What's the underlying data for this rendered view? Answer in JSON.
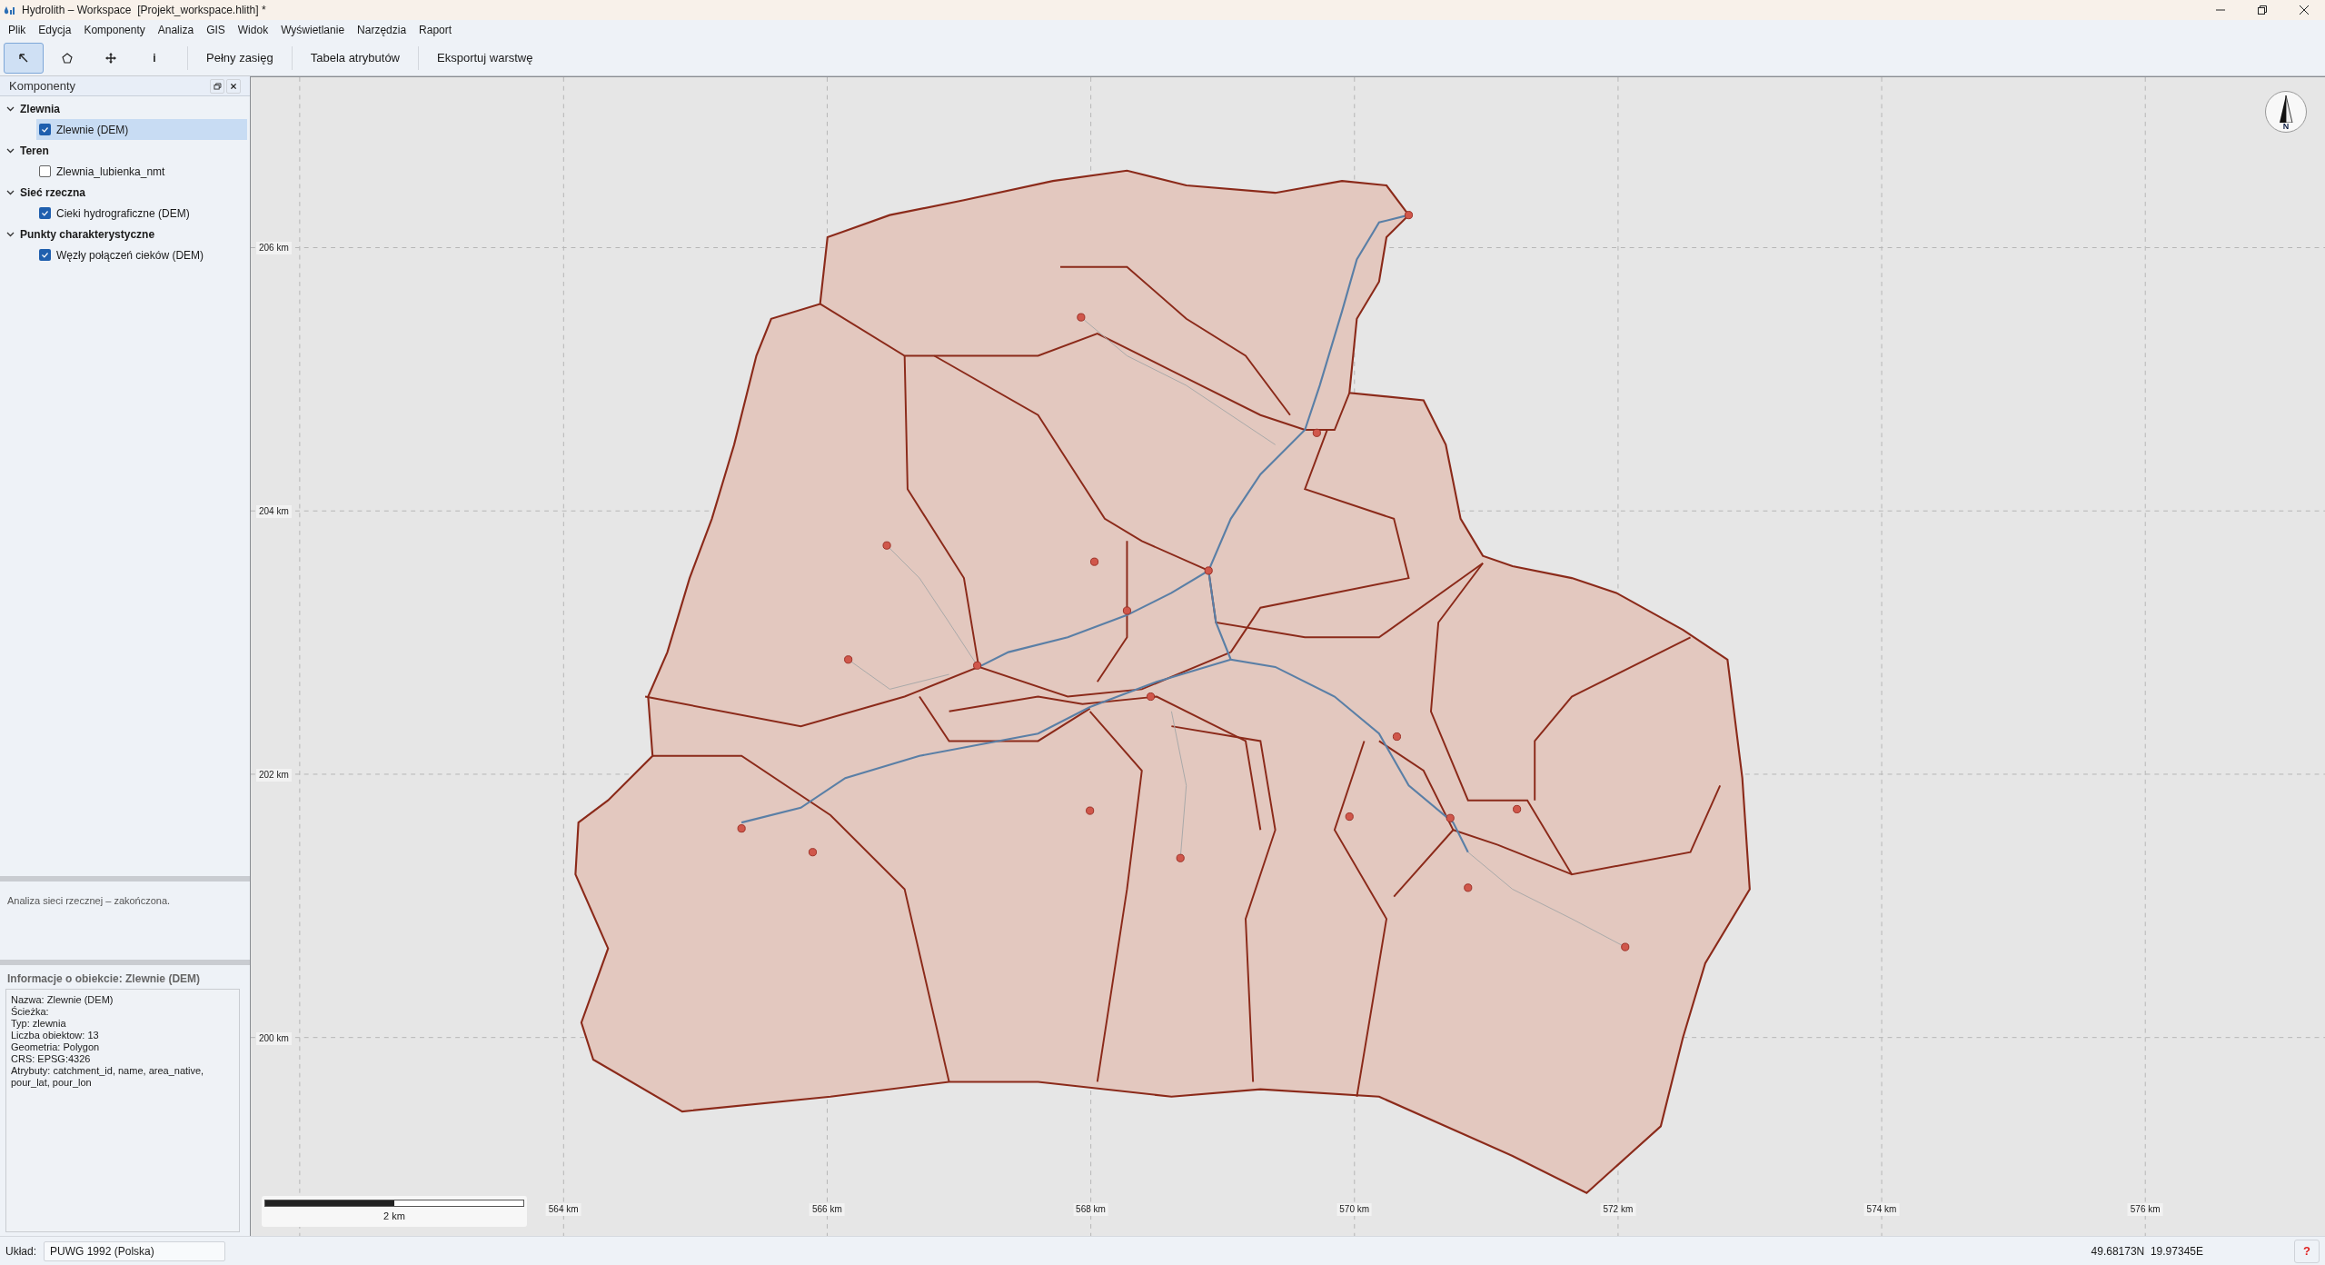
{
  "window": {
    "title": "Hydrolith – Workspace  [Projekt_workspace.hlith] *"
  },
  "menu": [
    "Plik",
    "Edycja",
    "Komponenty",
    "Analiza",
    "GIS",
    "Widok",
    "Wyświetlanie",
    "Narzędzia",
    "Raport"
  ],
  "toolbar": {
    "tools": [
      {
        "kind": "select",
        "selected": true
      },
      {
        "kind": "polygon",
        "selected": false
      },
      {
        "kind": "pan",
        "selected": false
      },
      {
        "kind": "info",
        "label": "i",
        "selected": false
      }
    ],
    "buttons": [
      "Pełny zasięg",
      "Tabela atrybutów",
      "Eksportuj warstwę"
    ]
  },
  "components_panel": {
    "title": "Komponenty",
    "groups": [
      {
        "label": "Zlewnia",
        "expanded": true,
        "children": [
          {
            "label": "Zlewnie (DEM)",
            "checked": true,
            "selected": true
          }
        ]
      },
      {
        "label": "Teren",
        "expanded": true,
        "children": [
          {
            "label": "Zlewnia_lubienka_nmt",
            "checked": false,
            "selected": false
          }
        ]
      },
      {
        "label": "Sieć rzeczna",
        "expanded": true,
        "children": [
          {
            "label": "Cieki hydrograficzne (DEM)",
            "checked": true,
            "selected": false
          }
        ]
      },
      {
        "label": "Punkty charakterystyczne",
        "expanded": true,
        "children": [
          {
            "label": "Węzły połączeń cieków (DEM)",
            "checked": true,
            "selected": false
          }
        ]
      }
    ]
  },
  "log": {
    "text": "Analiza sieci rzecznej – zakończona."
  },
  "info": {
    "title": "Informacje o obiekcie: Zlewnie (DEM)",
    "lines": [
      "Nazwa: Zlewnie (DEM)",
      "Ścieżka:",
      "Typ: zlewnia",
      "Liczba obiektow: 13",
      "Geometria: Polygon",
      "CRS: EPSG:4326",
      "Atrybuty: catchment_id, name, area_native, pour_lat, pour_lon"
    ]
  },
  "map": {
    "y_ticks": [
      "206 km",
      "204 km",
      "202 km",
      "200 km"
    ],
    "x_ticks": [
      "564 km",
      "566 km",
      "568 km",
      "570 km",
      "572 km",
      "574 km",
      "576 km"
    ],
    "scale_bar": {
      "label": "2 km"
    },
    "compass": {
      "label": "N"
    }
  },
  "status_bar": {
    "crs_label": "Układ:",
    "crs_value": "PUWG 1992 (Polska)",
    "coordinates": "49.68173N  19.97345E",
    "help": "?"
  }
}
